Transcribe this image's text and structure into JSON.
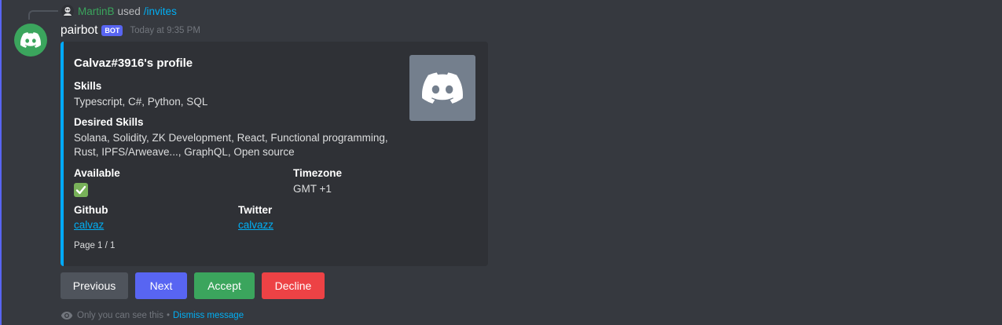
{
  "reply": {
    "user": "MartinB",
    "verb": "used",
    "command": "/invites"
  },
  "message": {
    "author": "pairbot",
    "bot_tag": "BOT",
    "timestamp": "Today at 9:35 PM"
  },
  "embed": {
    "accent_color": "#00aaff",
    "title": "Calvaz#3916's profile",
    "fields": {
      "skills": {
        "name": "Skills",
        "value": "Typescript, C#, Python, SQL"
      },
      "desired_skills": {
        "name": "Desired Skills",
        "value_line1": "Solana, Solidity, ZK Development, React, Functional programming,",
        "value_line2": "Rust, IPFS/Arweave..., GraphQL, Open source"
      },
      "available": {
        "name": "Available",
        "value_icon": "white-check-mark-icon"
      },
      "timezone": {
        "name": "Timezone",
        "value": "GMT +1"
      },
      "github": {
        "name": "Github",
        "value": "calvaz"
      },
      "twitter": {
        "name": "Twitter",
        "value": "calvazz"
      }
    },
    "footer": "Page 1 / 1",
    "thumbnail_icon": "discord-logo-icon"
  },
  "buttons": {
    "previous": "Previous",
    "next": "Next",
    "accept": "Accept",
    "decline": "Decline"
  },
  "ephemeral": {
    "note": "Only you can see this",
    "separator": "•",
    "dismiss": "Dismiss message"
  },
  "colors": {
    "background": "#36393f",
    "embed_bg": "#2f3136",
    "blurple": "#5865f2",
    "green": "#3ba55d",
    "red": "#ed4245",
    "link": "#00aff4"
  }
}
